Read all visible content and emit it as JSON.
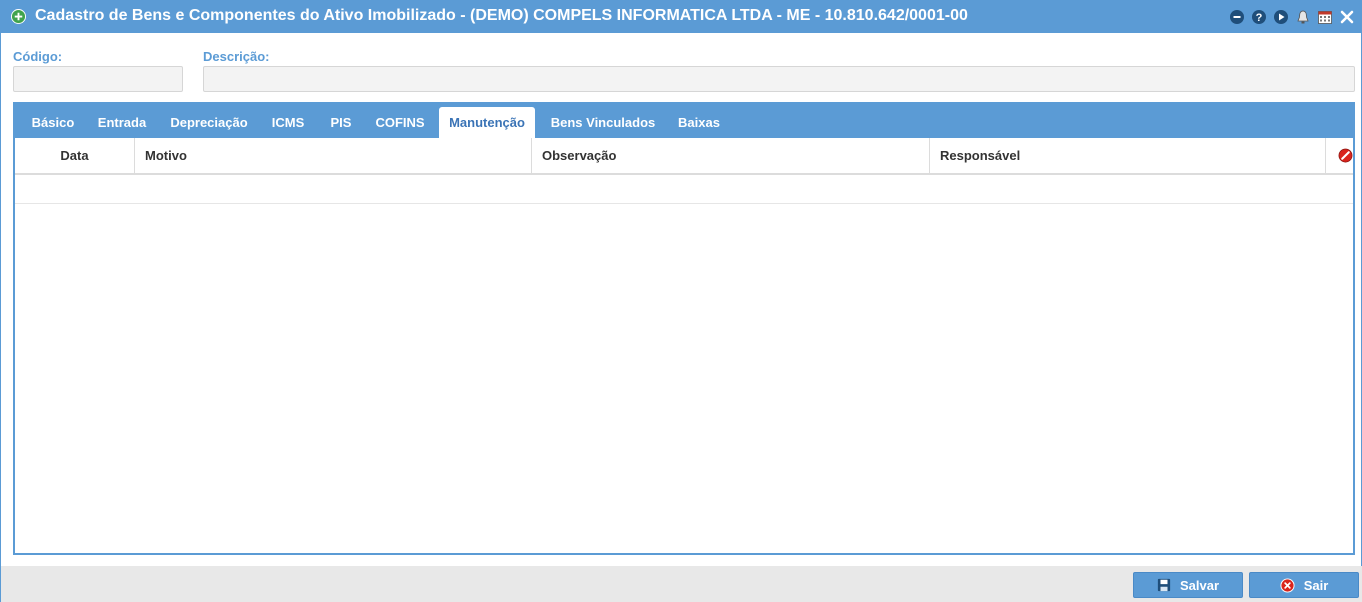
{
  "window": {
    "title": "Cadastro de Bens e Componentes do Ativo Imobilizado - (DEMO) COMPELS INFORMATICA LTDA - ME - 10.810.642/0001-00",
    "title_icon": "add-circle-icon",
    "toolbar_icons": [
      "minimize-icon",
      "help-icon",
      "play-icon",
      "bell-icon",
      "calendar-icon",
      "close-icon"
    ]
  },
  "form": {
    "codigo_label": "Código:",
    "codigo_value": "",
    "descricao_label": "Descrição:",
    "descricao_value": ""
  },
  "tabs": [
    {
      "label": "Básico",
      "active": false
    },
    {
      "label": "Entrada",
      "active": false
    },
    {
      "label": "Depreciação",
      "active": false
    },
    {
      "label": "ICMS",
      "active": false
    },
    {
      "label": "PIS",
      "active": false
    },
    {
      "label": "COFINS",
      "active": false
    },
    {
      "label": "Manutenção",
      "active": true
    },
    {
      "label": "Bens Vinculados",
      "active": false
    },
    {
      "label": "Baixas",
      "active": false
    }
  ],
  "grid": {
    "columns": [
      "Data",
      "Motivo",
      "Observação",
      "Responsável"
    ],
    "delete_icon": "delete-row-icon",
    "rows": []
  },
  "footer": {
    "save_label": "Salvar",
    "exit_label": "Sair"
  },
  "colors": {
    "accent": "#5b9bd5",
    "active_tab_text": "#3b74b6",
    "delete_red": "#d9241c",
    "title_icon_green": "#3fa34d"
  }
}
